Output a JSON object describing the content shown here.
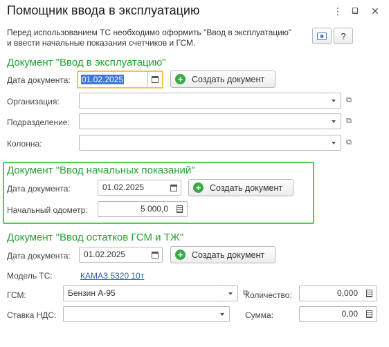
{
  "window": {
    "title": "Помощник ввода в эксплуатацию",
    "controls": {
      "menu": "⋮",
      "minimize": "–",
      "maximize": "☐",
      "close": "✕"
    }
  },
  "info_text": "Перед использованием ТС необходимо оформить \"Ввод в эксплуатацию\" и ввести начальные показания счетчиков и ГСМ.",
  "toolbar": {
    "help_label": "?"
  },
  "section_commissioning": {
    "title": "Документ \"Ввод в эксплуатацию\"",
    "date_label": "Дата документа:",
    "date_value": "01.02.2025",
    "create_button": "Создать документ",
    "organization_label": "Организация:",
    "organization_value": "",
    "department_label": "Подразделение:",
    "department_value": "",
    "column_label": "Колонна:",
    "column_value": ""
  },
  "section_initial_readings": {
    "title": "Документ \"Ввод начальных показаний\"",
    "date_label": "Дата документа:",
    "date_value": "01.02.2025",
    "create_button": "Создать документ",
    "odometer_label": "Начальный одометр:",
    "odometer_value": "5 000,0"
  },
  "section_fuel_balances": {
    "title": "Документ \"Ввод остатков ГСМ и ТЖ\"",
    "date_label": "Дата документа:",
    "date_value": "01.02.2025",
    "create_button": "Создать документ",
    "model_label": "Модель ТС:",
    "model_value": "КАМАЗ 5320 10т",
    "fuel_label": "ГСМ:",
    "fuel_value": "Бензин А-95",
    "quantity_label": "Количество:",
    "quantity_value": "0,000",
    "vat_label": "Ставка НДС:",
    "vat_value": "",
    "sum_label": "Сумма:",
    "sum_value": "0,00"
  },
  "colors": {
    "section_title": "#22a335",
    "highlight_border": "#3dd64a",
    "focus_border": "#f5c243",
    "link": "#2a5db0"
  }
}
